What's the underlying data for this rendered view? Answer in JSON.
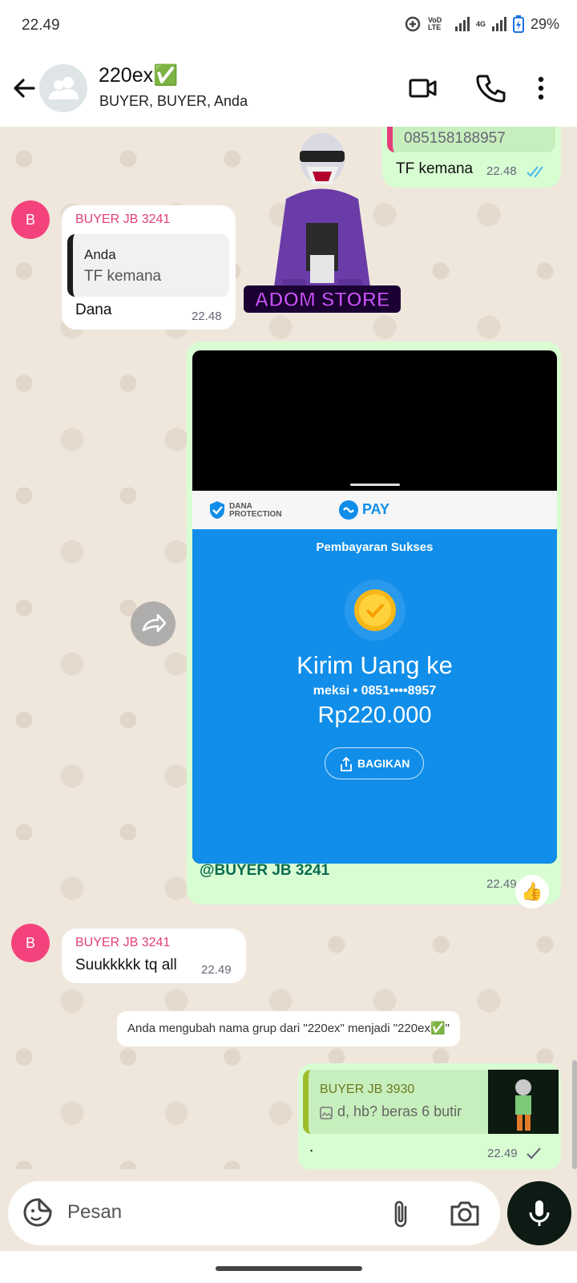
{
  "status_bar": {
    "time": "22.49",
    "volte": "VoD LTE",
    "network": "4G",
    "battery": "29%"
  },
  "header": {
    "title": "220ex✅",
    "subtitle": "BUYER, BUYER, Anda"
  },
  "messages": {
    "out_top": {
      "phone": "085158188957",
      "text": "TF kemana",
      "time": "22.48"
    },
    "in_reply": {
      "avatar_letter": "B",
      "sender": "BUYER JB 3241",
      "quote_author": "Anda",
      "quote_text": "TF kemana",
      "text": "Dana",
      "time": "22.48"
    },
    "sticker_caption": "ADOM STORE",
    "media": {
      "dana_protection": "DANA PROTECTION",
      "pay_label": "PAY",
      "status": "Pembayaran Sukses",
      "heading": "Kirim Uang ke",
      "recipient": "meksi • 0851••••8957",
      "amount": "Rp220.000",
      "share_button": "BAGIKAN",
      "caption": "@BUYER JB 3241",
      "time": "22.49",
      "reaction": "👍"
    },
    "in_second": {
      "avatar_letter": "B",
      "sender": "BUYER JB 3241",
      "text": "Suukkkkk tq all",
      "time": "22.49"
    },
    "system": "Anda mengubah nama grup dari \"220ex\" menjadi \"220ex✅\"",
    "out_last": {
      "quote_author": "BUYER JB 3930",
      "quote_text": "d, hb? beras 6 butir",
      "text": ".",
      "time": "22.49"
    }
  },
  "input": {
    "placeholder": "Pesan"
  },
  "colors": {
    "accent_green": "#25d366",
    "bubble_out": "#d9fdd3",
    "sender_pink": "#e23f7a",
    "read_tick": "#53bdeb"
  }
}
